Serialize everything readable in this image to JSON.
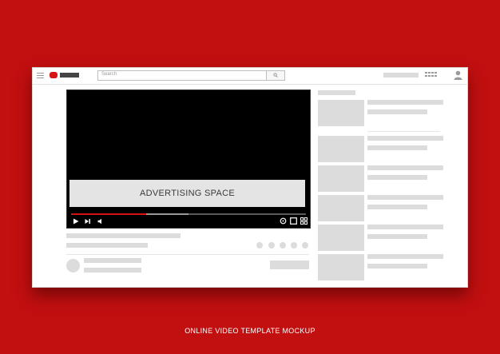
{
  "brand": {
    "accent_color": "#d61414",
    "background_color": "#c20f10"
  },
  "header": {
    "menu_icon": "hamburger-icon",
    "logo_icon": "play-logo-icon",
    "search": {
      "placeholder": "Search",
      "button_icon": "search-icon"
    },
    "apps_icon": "grid-icon",
    "account_icon": "user-icon"
  },
  "player": {
    "ad_text": "ADVERTISING SPACE",
    "progress": 0.32,
    "buffered": 0.18,
    "controls": [
      "play-icon",
      "next-icon",
      "volume-icon",
      "settings-icon",
      "miniplayer-icon",
      "fullscreen-icon"
    ]
  },
  "footer": {
    "caption": "ONLINE VIDEO TEMPLATE MOCKUP"
  }
}
